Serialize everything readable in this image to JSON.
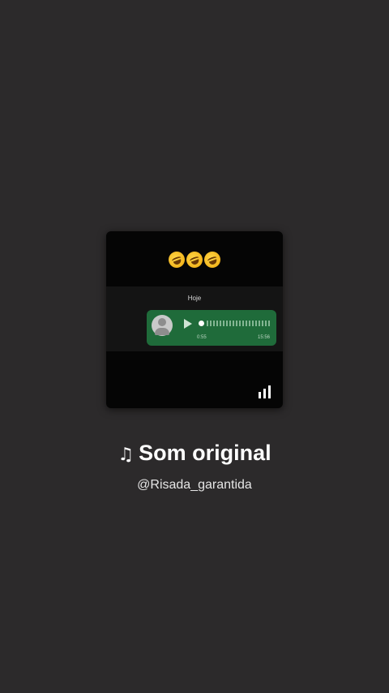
{
  "cover": {
    "emojis": [
      "rolling-on-floor-laughing",
      "rolling-on-floor-laughing",
      "rolling-on-floor-laughing"
    ],
    "chat_day_label": "Hoje",
    "voice_duration": "0:55",
    "voice_time": "15:56"
  },
  "sound": {
    "note_icon": "♫",
    "title": "Som original",
    "author": "@Risada_garantida"
  },
  "colors": {
    "background": "#2c2a2b",
    "bubble": "#1f6b3a"
  }
}
